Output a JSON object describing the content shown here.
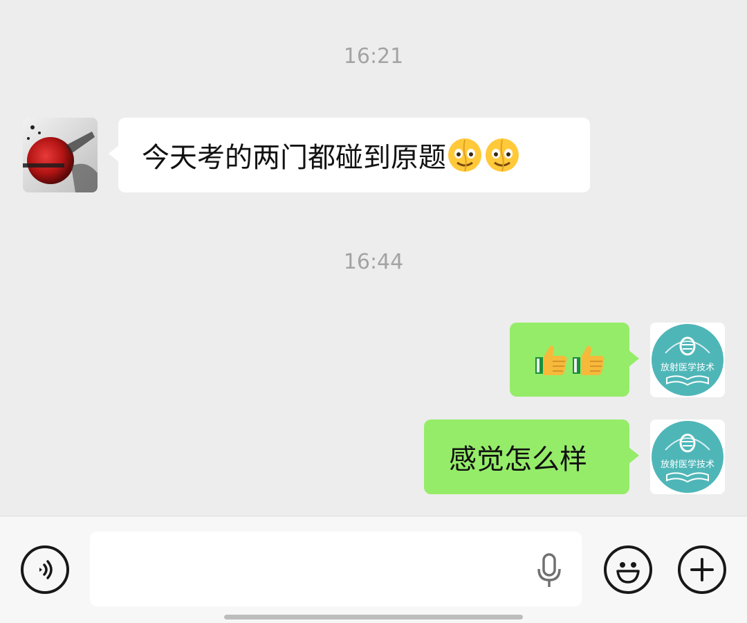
{
  "chat": {
    "messages": [
      {
        "type": "timestamp",
        "text": "16:21"
      },
      {
        "type": "incoming",
        "text": "今天考的两门都碰到原题",
        "emoji": [
          "melting-face-emoji",
          "melting-face-emoji"
        ]
      },
      {
        "type": "timestamp",
        "text": "16:44"
      },
      {
        "type": "outgoing",
        "text": "",
        "emoji": [
          "thumbs-up-emoji",
          "thumbs-up-emoji"
        ]
      },
      {
        "type": "outgoing",
        "text": "感觉怎么样"
      }
    ],
    "self_avatar_text": "放射医学技术"
  },
  "input_bar": {
    "text_value": "",
    "icons": {
      "voice": "voice-toggle-icon",
      "mic": "microphone-icon",
      "emoji": "emoji-icon",
      "plus": "plus-icon"
    }
  },
  "colors": {
    "chat_bg": "#ededed",
    "outgoing_bubble": "#95ec69",
    "incoming_bubble": "#ffffff",
    "timestamp": "#a3a3a3",
    "avatar_teal": "#4fb6b8"
  }
}
